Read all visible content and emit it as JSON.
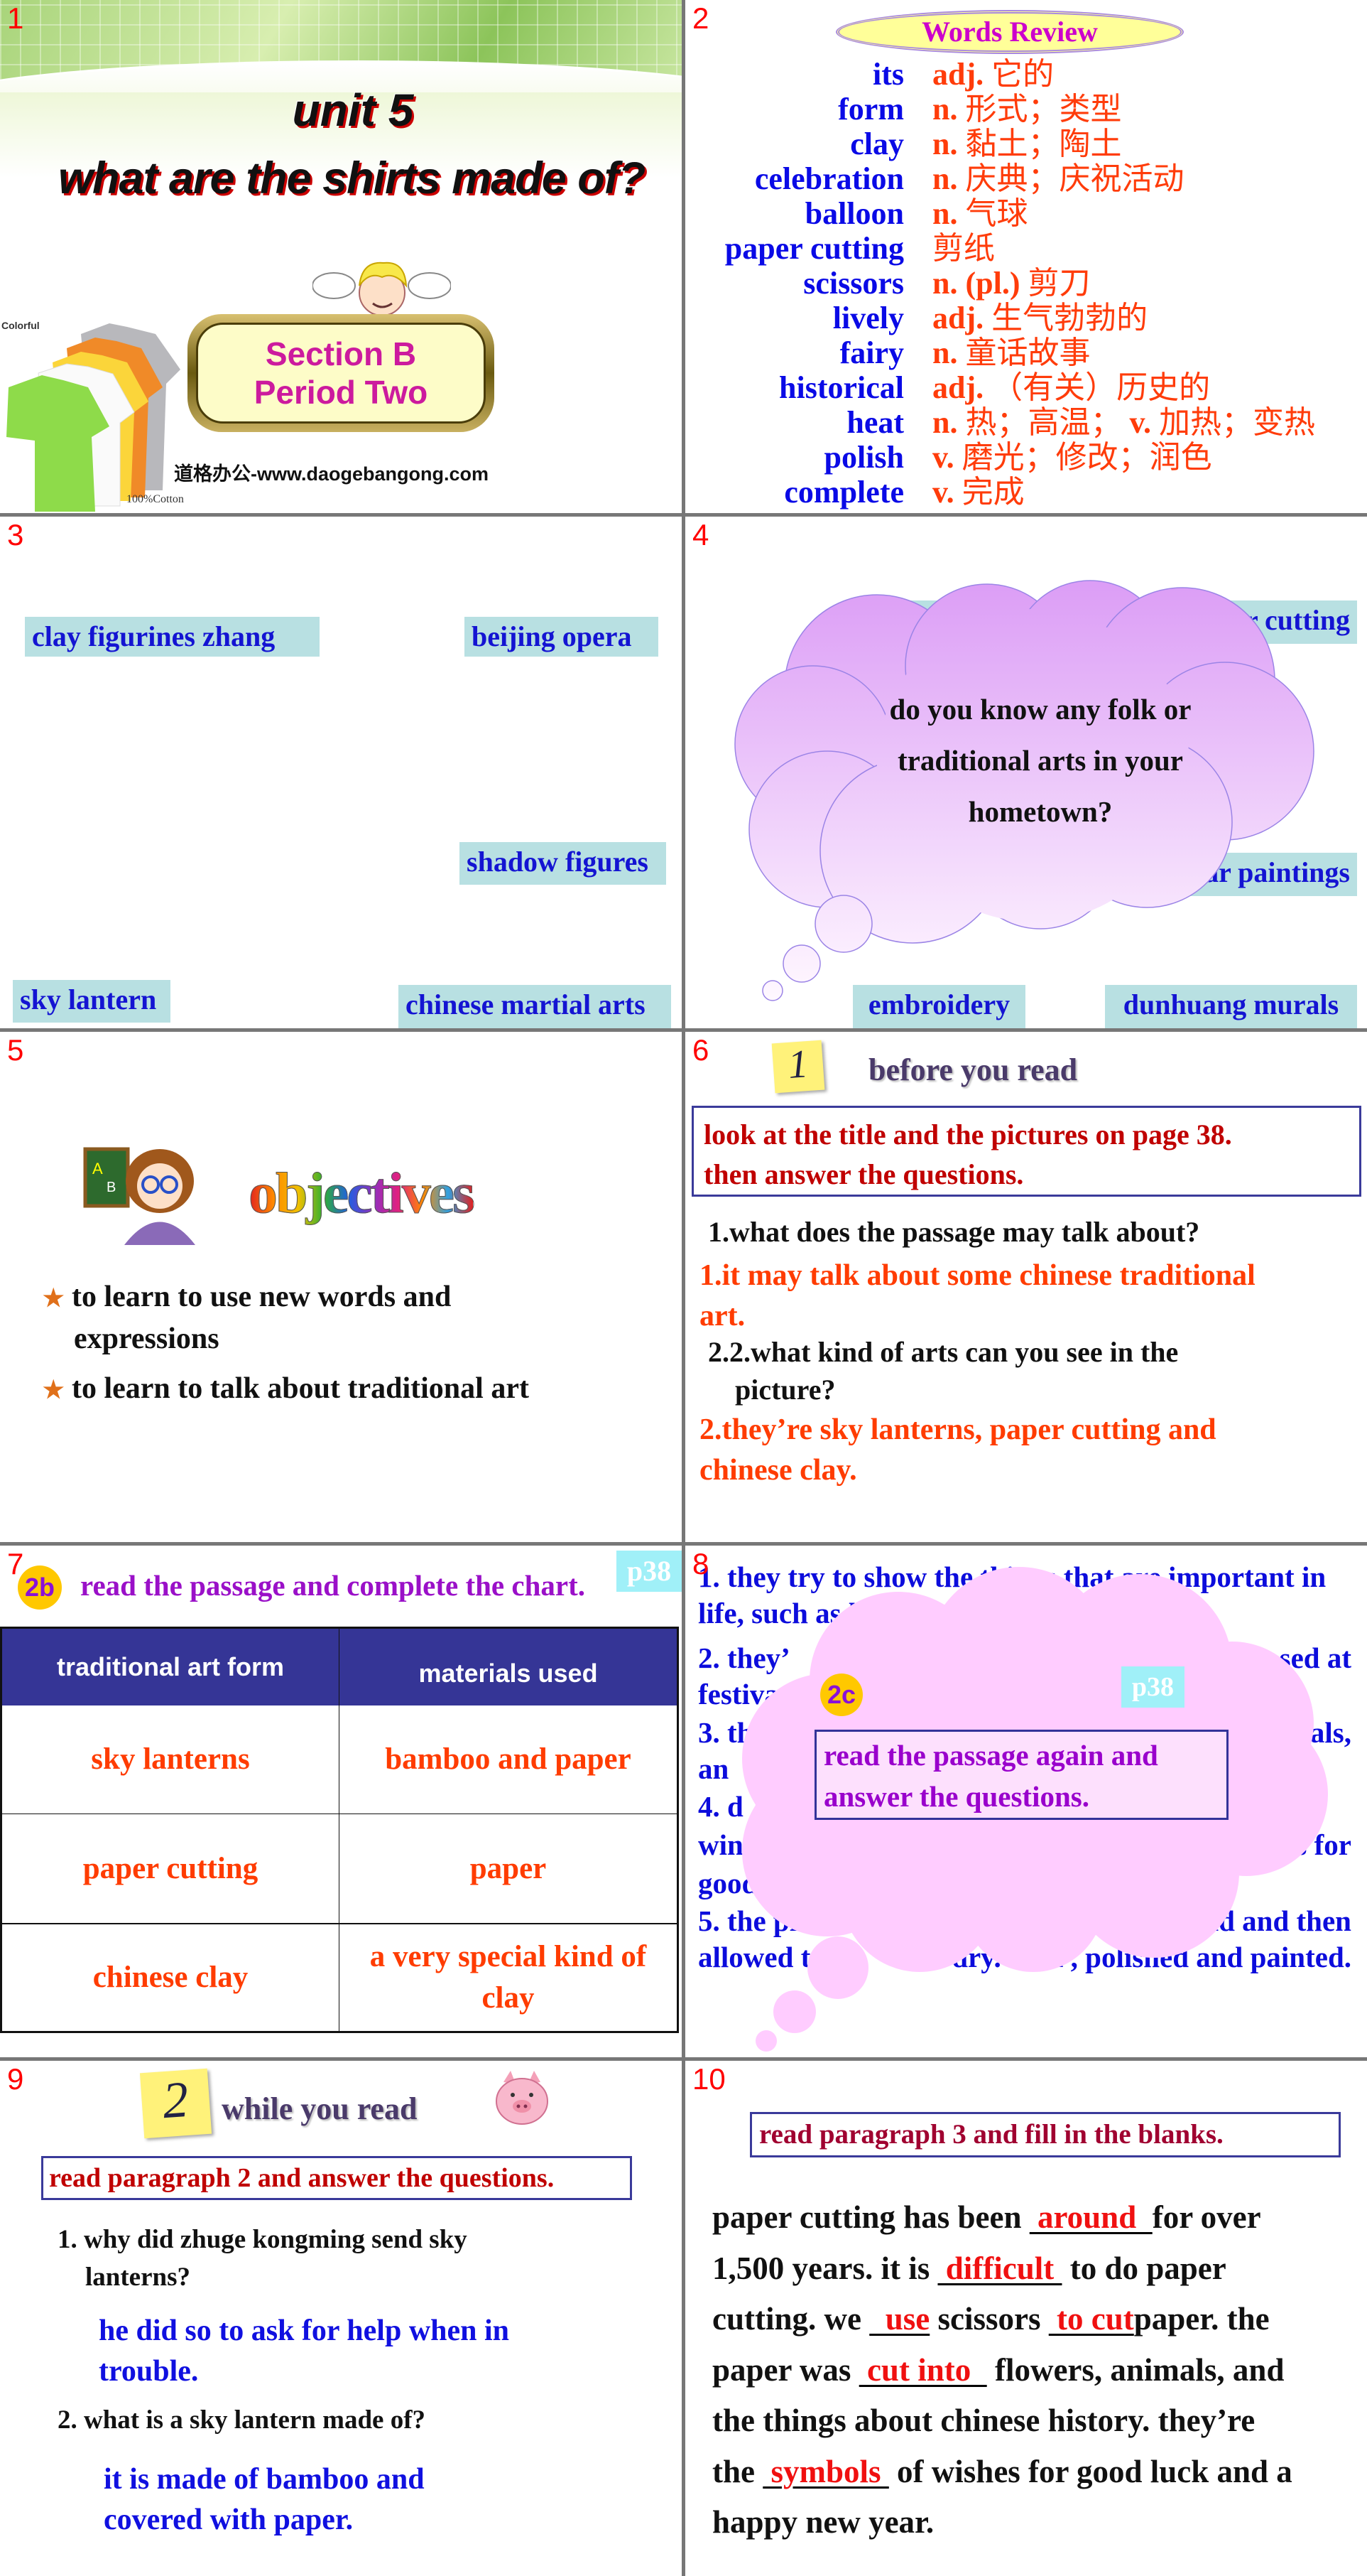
{
  "slides": {
    "s1": {
      "number": "1",
      "unit": "unit 5",
      "title": "what are the shirts made of?",
      "section": "Section B",
      "period": "Period Two",
      "website": "道格办公-www.daogebangong.com",
      "shirt_label_top": "Colorful",
      "shirt_label_bottom": "100%Cotton"
    },
    "s2": {
      "number": "2",
      "banner": "Words Review",
      "words": [
        {
          "word": "its",
          "pos": "adj.",
          "meaning": "它的"
        },
        {
          "word": "form",
          "pos": "n.",
          "meaning": "形式；类型"
        },
        {
          "word": "clay",
          "pos": "n.",
          "meaning": "黏土；陶土"
        },
        {
          "word": "celebration",
          "pos": "n.",
          "meaning": "庆典；庆祝活动"
        },
        {
          "word": "balloon",
          "pos": "n.",
          "meaning": "气球"
        },
        {
          "word": "paper cutting",
          "pos": "",
          "meaning": "剪纸"
        },
        {
          "word": "scissors",
          "pos": "n. (pl.)",
          "meaning": "剪刀"
        },
        {
          "word": "lively",
          "pos": "adj.",
          "meaning": "生气勃勃的"
        },
        {
          "word": "fairy",
          "pos": "n.",
          "meaning": "童话故事"
        },
        {
          "word": "historical",
          "pos": "adj.",
          "meaning": "（有关）历史的"
        },
        {
          "word": "heat",
          "pos": "n.",
          "meaning": "热；高温；",
          "pos2": "v.",
          "meaning2": "加热；变热"
        },
        {
          "word": "polish",
          "pos": "v.",
          "meaning": "磨光；修改；润色"
        },
        {
          "word": "complete",
          "pos": "v.",
          "meaning": "完成"
        }
      ]
    },
    "s3": {
      "number": "3",
      "labels": [
        "clay figurines zhang",
        "beijing opera",
        "shadow figures",
        "sky lantern",
        "chinese martial arts"
      ]
    },
    "s4": {
      "number": "4",
      "labels": [
        "cl",
        "r cutting",
        "new year paintings",
        "embroidery",
        "dunhuang murals"
      ],
      "question_lines": [
        "do you know any folk or",
        "traditional arts in your",
        "hometown?"
      ]
    },
    "s5": {
      "number": "5",
      "heading": "objectives",
      "bullets": [
        "to learn to use new words and",
        "expressions",
        "to learn to talk about traditional art"
      ]
    },
    "s6": {
      "number": "6",
      "step": "1",
      "heading": "before you read",
      "instruction": [
        "look at the title and the pictures on page 38.",
        "then answer the questions."
      ],
      "q1": "1.what does the passage may talk about?",
      "a1": [
        "1.it may talk about some chinese traditional",
        "art."
      ],
      "q2": [
        "2.2.what kind of arts can you see in the",
        "picture?"
      ],
      "a2": [
        "2.they’re sky lanterns, paper cutting and",
        "chinese clay."
      ]
    },
    "s7": {
      "number": "7",
      "badge": "2b",
      "instruction": "read the passage and complete the chart.",
      "page_tag": "p38",
      "table": {
        "headers": [
          "traditional art form",
          "materials used"
        ],
        "rows": [
          [
            "sky lanterns",
            "bamboo and paper"
          ],
          [
            "paper cutting",
            "paper"
          ],
          [
            "chinese clay",
            "a very special kind of clay"
          ]
        ]
      }
    },
    "s8": {
      "number": "8",
      "badge": "2c",
      "page_tag": "p38",
      "instruction": [
        "read the passage again and",
        "answer the questions."
      ],
      "lines": [
        {
          "left": "1. they try to show the things that are important in",
          "right": ""
        },
        {
          "left": "life, such as love, be",
          "right": ""
        },
        {
          "left": "2. they’",
          "right": "sed at"
        },
        {
          "left": "festiva",
          "right": ""
        },
        {
          "left": "3. th",
          "right": "als,"
        },
        {
          "left": "an",
          "right": ""
        },
        {
          "left": "4. d",
          "right": ""
        },
        {
          "left": "win",
          "right": "es for"
        },
        {
          "left": "good",
          "right": ""
        },
        {
          "left": "5. the piec",
          "right": "by hand and then"
        },
        {
          "left": "allowed t",
          "right": "r-dry. then      , polished and painted."
        }
      ]
    },
    "s9": {
      "number": "9",
      "step": "2",
      "heading": "while you read",
      "instruction": "read paragraph 2 and answer the questions.",
      "q1": [
        "1.  why did zhuge kongming send sky",
        "lanterns?"
      ],
      "a1": [
        "he did so to ask for help when in",
        "trouble."
      ],
      "q2": "2.  what is a sky lantern made of?",
      "a2": [
        "it is made of bamboo and",
        "covered with paper."
      ]
    },
    "s10": {
      "number": "10",
      "instruction": "read paragraph 3 and fill in the blanks.",
      "text": {
        "l1a": "paper cutting has been ",
        "b1": " around  ",
        "l1b": "for over",
        "l2a": "1,500 years. it is ",
        "b2": " difficult ",
        "l2b": " to do paper",
        "l3a": "cutting. we ",
        "b3": "  use",
        "l3b": " scissors ",
        "b4": " to cut",
        "l3c": "paper. the",
        "l4a": "paper was ",
        "b5": " cut into  ",
        "l4b": " flowers, animals, and",
        "l5": "the things about chinese history. they’re",
        "l6a": "the ",
        "b6": " symbols ",
        "l6b": " of wishes for good luck and a",
        "l7": "happy new year."
      }
    }
  },
  "colors": {
    "slide_number": "#ff0000",
    "word_blue": "#0a0ae6",
    "definition_red": "#ff3c0a",
    "label_bg": "#b8e0e2",
    "table_header": "#353596",
    "answer_orange": "#ff3c00",
    "cloud_pink": "#ffccff",
    "page_tag_bg": "#a0f0f8"
  }
}
